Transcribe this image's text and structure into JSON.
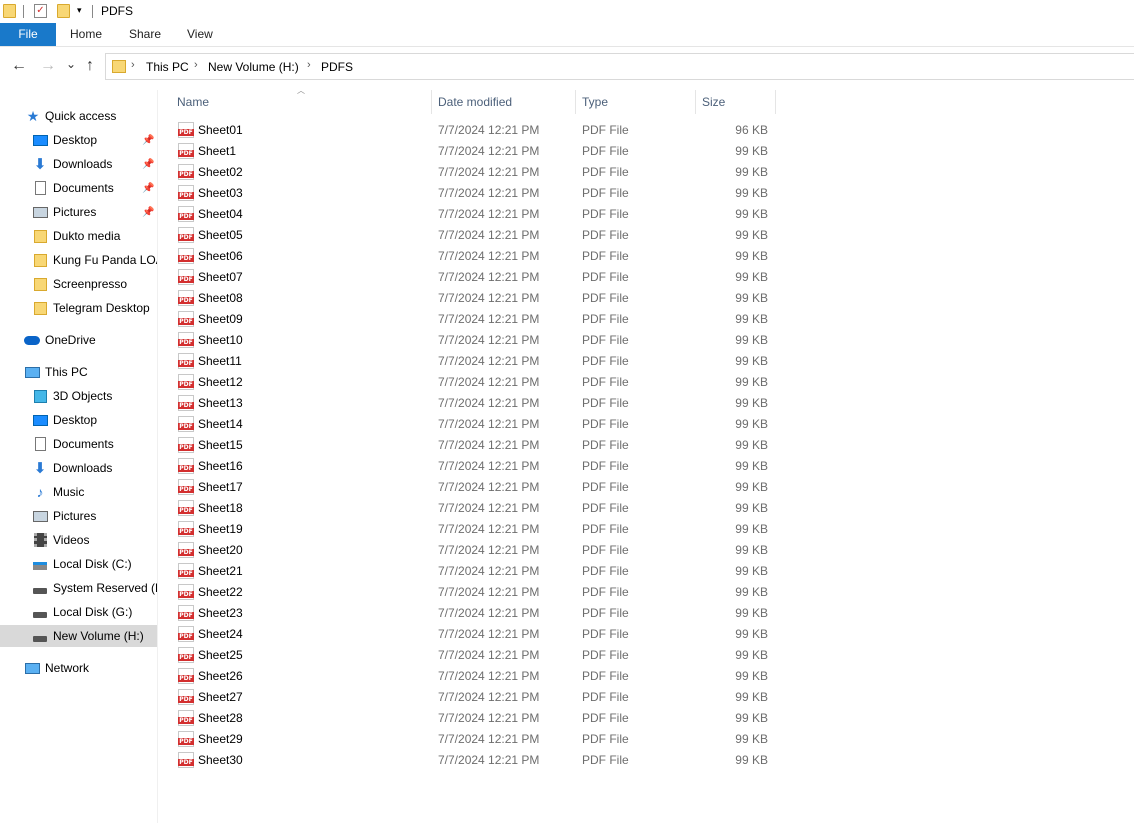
{
  "window": {
    "title": "PDFS"
  },
  "ribbon": {
    "file": "File",
    "home": "Home",
    "share": "Share",
    "view": "View"
  },
  "nav": {
    "back": "←",
    "forward": "→",
    "recent": "⌄",
    "up": "↑",
    "breadcrumb": [
      "This PC",
      "New Volume (H:)",
      "PDFS"
    ]
  },
  "sidebar": {
    "quick_access": "Quick access",
    "quick_items": [
      {
        "label": "Desktop",
        "icon": "desktop-icon"
      },
      {
        "label": "Downloads",
        "icon": "downloads-icon"
      },
      {
        "label": "Documents",
        "icon": "documents-icon"
      },
      {
        "label": "Pictures",
        "icon": "pictures-icon"
      },
      {
        "label": "Dukto media",
        "icon": "folder-icon"
      },
      {
        "label": "Kung Fu Panda LOA",
        "icon": "folder-icon"
      },
      {
        "label": "Screenpresso",
        "icon": "folder-icon"
      },
      {
        "label": "Telegram Desktop",
        "icon": "folder-icon"
      }
    ],
    "onedrive": "OneDrive",
    "this_pc": "This PC",
    "pc_items": [
      {
        "label": "3D Objects",
        "icon": "3d-objects-icon"
      },
      {
        "label": "Desktop",
        "icon": "desktop-icon"
      },
      {
        "label": "Documents",
        "icon": "documents-icon"
      },
      {
        "label": "Downloads",
        "icon": "downloads-icon"
      },
      {
        "label": "Music",
        "icon": "music-icon"
      },
      {
        "label": "Pictures",
        "icon": "pictures-icon"
      },
      {
        "label": "Videos",
        "icon": "videos-icon"
      },
      {
        "label": "Local Disk (C:)",
        "icon": "drive-c-icon"
      },
      {
        "label": "System Reserved (E:",
        "icon": "drive-icon"
      },
      {
        "label": "Local Disk (G:)",
        "icon": "drive-icon"
      },
      {
        "label": "New Volume (H:)",
        "icon": "drive-icon"
      }
    ],
    "network": "Network"
  },
  "columns": {
    "name": "Name",
    "date": "Date modified",
    "type": "Type",
    "size": "Size"
  },
  "files": [
    {
      "name": "Sheet01",
      "date": "7/7/2024 12:21 PM",
      "type": "PDF File",
      "size": "96 KB"
    },
    {
      "name": "Sheet1",
      "date": "7/7/2024 12:21 PM",
      "type": "PDF File",
      "size": "99 KB"
    },
    {
      "name": "Sheet02",
      "date": "7/7/2024 12:21 PM",
      "type": "PDF File",
      "size": "99 KB"
    },
    {
      "name": "Sheet03",
      "date": "7/7/2024 12:21 PM",
      "type": "PDF File",
      "size": "99 KB"
    },
    {
      "name": "Sheet04",
      "date": "7/7/2024 12:21 PM",
      "type": "PDF File",
      "size": "99 KB"
    },
    {
      "name": "Sheet05",
      "date": "7/7/2024 12:21 PM",
      "type": "PDF File",
      "size": "99 KB"
    },
    {
      "name": "Sheet06",
      "date": "7/7/2024 12:21 PM",
      "type": "PDF File",
      "size": "99 KB"
    },
    {
      "name": "Sheet07",
      "date": "7/7/2024 12:21 PM",
      "type": "PDF File",
      "size": "99 KB"
    },
    {
      "name": "Sheet08",
      "date": "7/7/2024 12:21 PM",
      "type": "PDF File",
      "size": "99 KB"
    },
    {
      "name": "Sheet09",
      "date": "7/7/2024 12:21 PM",
      "type": "PDF File",
      "size": "99 KB"
    },
    {
      "name": "Sheet10",
      "date": "7/7/2024 12:21 PM",
      "type": "PDF File",
      "size": "99 KB"
    },
    {
      "name": "Sheet11",
      "date": "7/7/2024 12:21 PM",
      "type": "PDF File",
      "size": "99 KB"
    },
    {
      "name": "Sheet12",
      "date": "7/7/2024 12:21 PM",
      "type": "PDF File",
      "size": "99 KB"
    },
    {
      "name": "Sheet13",
      "date": "7/7/2024 12:21 PM",
      "type": "PDF File",
      "size": "99 KB"
    },
    {
      "name": "Sheet14",
      "date": "7/7/2024 12:21 PM",
      "type": "PDF File",
      "size": "99 KB"
    },
    {
      "name": "Sheet15",
      "date": "7/7/2024 12:21 PM",
      "type": "PDF File",
      "size": "99 KB"
    },
    {
      "name": "Sheet16",
      "date": "7/7/2024 12:21 PM",
      "type": "PDF File",
      "size": "99 KB"
    },
    {
      "name": "Sheet17",
      "date": "7/7/2024 12:21 PM",
      "type": "PDF File",
      "size": "99 KB"
    },
    {
      "name": "Sheet18",
      "date": "7/7/2024 12:21 PM",
      "type": "PDF File",
      "size": "99 KB"
    },
    {
      "name": "Sheet19",
      "date": "7/7/2024 12:21 PM",
      "type": "PDF File",
      "size": "99 KB"
    },
    {
      "name": "Sheet20",
      "date": "7/7/2024 12:21 PM",
      "type": "PDF File",
      "size": "99 KB"
    },
    {
      "name": "Sheet21",
      "date": "7/7/2024 12:21 PM",
      "type": "PDF File",
      "size": "99 KB"
    },
    {
      "name": "Sheet22",
      "date": "7/7/2024 12:21 PM",
      "type": "PDF File",
      "size": "99 KB"
    },
    {
      "name": "Sheet23",
      "date": "7/7/2024 12:21 PM",
      "type": "PDF File",
      "size": "99 KB"
    },
    {
      "name": "Sheet24",
      "date": "7/7/2024 12:21 PM",
      "type": "PDF File",
      "size": "99 KB"
    },
    {
      "name": "Sheet25",
      "date": "7/7/2024 12:21 PM",
      "type": "PDF File",
      "size": "99 KB"
    },
    {
      "name": "Sheet26",
      "date": "7/7/2024 12:21 PM",
      "type": "PDF File",
      "size": "99 KB"
    },
    {
      "name": "Sheet27",
      "date": "7/7/2024 12:21 PM",
      "type": "PDF File",
      "size": "99 KB"
    },
    {
      "name": "Sheet28",
      "date": "7/7/2024 12:21 PM",
      "type": "PDF File",
      "size": "99 KB"
    },
    {
      "name": "Sheet29",
      "date": "7/7/2024 12:21 PM",
      "type": "PDF File",
      "size": "99 KB"
    },
    {
      "name": "Sheet30",
      "date": "7/7/2024 12:21 PM",
      "type": "PDF File",
      "size": "99 KB"
    }
  ]
}
